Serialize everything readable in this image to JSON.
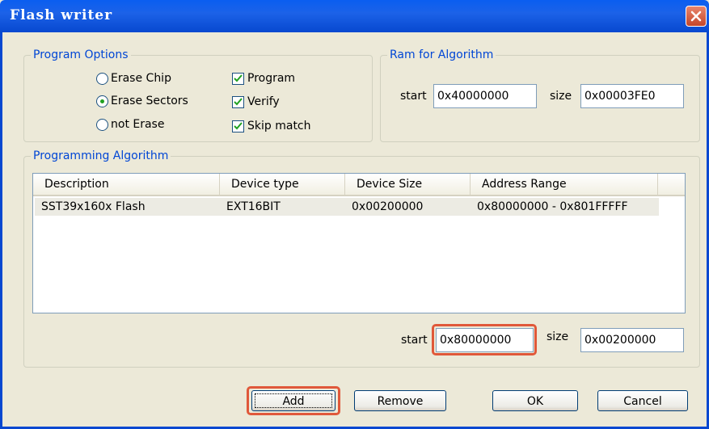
{
  "window": {
    "title": "Flash writer"
  },
  "program_options": {
    "title": "Program Options",
    "radios": [
      {
        "label": "Erase Chip",
        "checked": false
      },
      {
        "label": "Erase Sectors",
        "checked": true
      },
      {
        "label": "not Erase",
        "checked": false
      }
    ],
    "checkboxes": [
      {
        "label": "Program",
        "checked": true
      },
      {
        "label": "Verify",
        "checked": true
      },
      {
        "label": "Skip match",
        "checked": true
      }
    ]
  },
  "ram": {
    "title": "Ram for Algorithm",
    "start_label": "start",
    "start_value": "0x40000000",
    "size_label": "size",
    "size_value": "0x00003FE0"
  },
  "algorithm": {
    "title": "Programming Algorithm",
    "columns": [
      "Description",
      "Device type",
      "Device Size",
      "Address Range"
    ],
    "rows": [
      [
        "SST39x160x Flash",
        "EXT16BIT",
        "0x00200000",
        "0x80000000 - 0x801FFFFF"
      ]
    ],
    "start_label": "start",
    "start_value": "0x80000000",
    "size_label": "size",
    "size_value": "0x00200000"
  },
  "buttons": {
    "add": "Add",
    "remove": "Remove",
    "ok": "OK",
    "cancel": "Cancel"
  },
  "colors": {
    "highlight": "#e0583a",
    "title_bar": "#0a5ef0",
    "legend": "#0046d5"
  }
}
